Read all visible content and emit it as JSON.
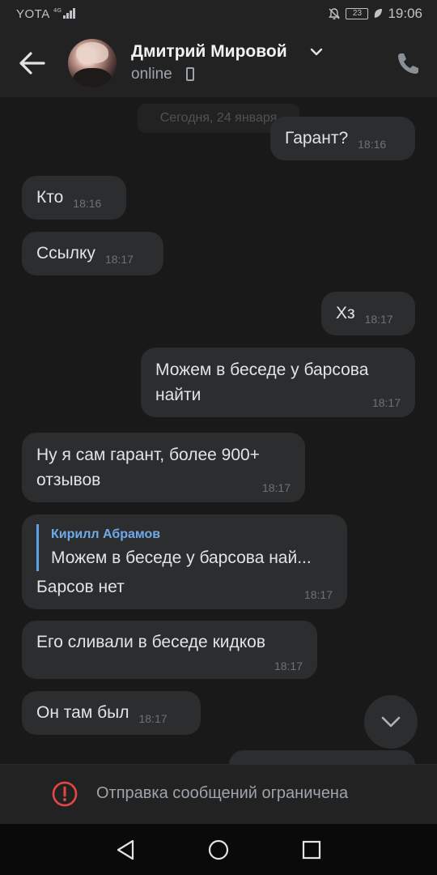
{
  "status_bar": {
    "carrier": "YOTA",
    "battery": "23",
    "time": "19:06"
  },
  "header": {
    "contact_name": "Дмитрий Мировой",
    "presence": "online"
  },
  "chat": {
    "date_separator": "Сегодня, 24 января",
    "messages": [
      {
        "direction": "out",
        "text": "Гарант?",
        "time": "18:16"
      },
      {
        "direction": "in",
        "text": "Кто",
        "time": "18:16"
      },
      {
        "direction": "in",
        "text": "Ссылку",
        "time": "18:17"
      },
      {
        "direction": "out",
        "text": "Хз",
        "time": "18:17"
      },
      {
        "direction": "out",
        "text": "Можем в беседе у барсова найти",
        "time": "18:17"
      },
      {
        "direction": "in",
        "text": "Ну я сам гарант, более 900+ отзывов",
        "time": "18:17"
      },
      {
        "direction": "in",
        "reply_author": "Кирилл Абрамов",
        "reply_text": "Можем в беседе у барсова най...",
        "text": "Барсов нет",
        "time": "18:17"
      },
      {
        "direction": "in",
        "text": "Его сливали в беседе кидков",
        "time": "18:17"
      },
      {
        "direction": "in",
        "text": "Он там был",
        "time": "18:17"
      }
    ]
  },
  "restriction": {
    "message": "Отправка сообщений ограничена"
  },
  "icons": {
    "back": "arrow-left-icon",
    "dropdown": "chevron-down-icon",
    "device": "mobile-device-icon",
    "call": "phone-icon",
    "scroll_down": "chevron-down-icon",
    "warning": "exclamation-circle-icon",
    "nav": [
      "triangle-back-icon",
      "circle-home-icon",
      "square-recents-icon"
    ]
  },
  "colors": {
    "background": "#19191a",
    "bubble": "#2c2d2e",
    "accent": "#71aaeb",
    "warning": "#e64646"
  }
}
